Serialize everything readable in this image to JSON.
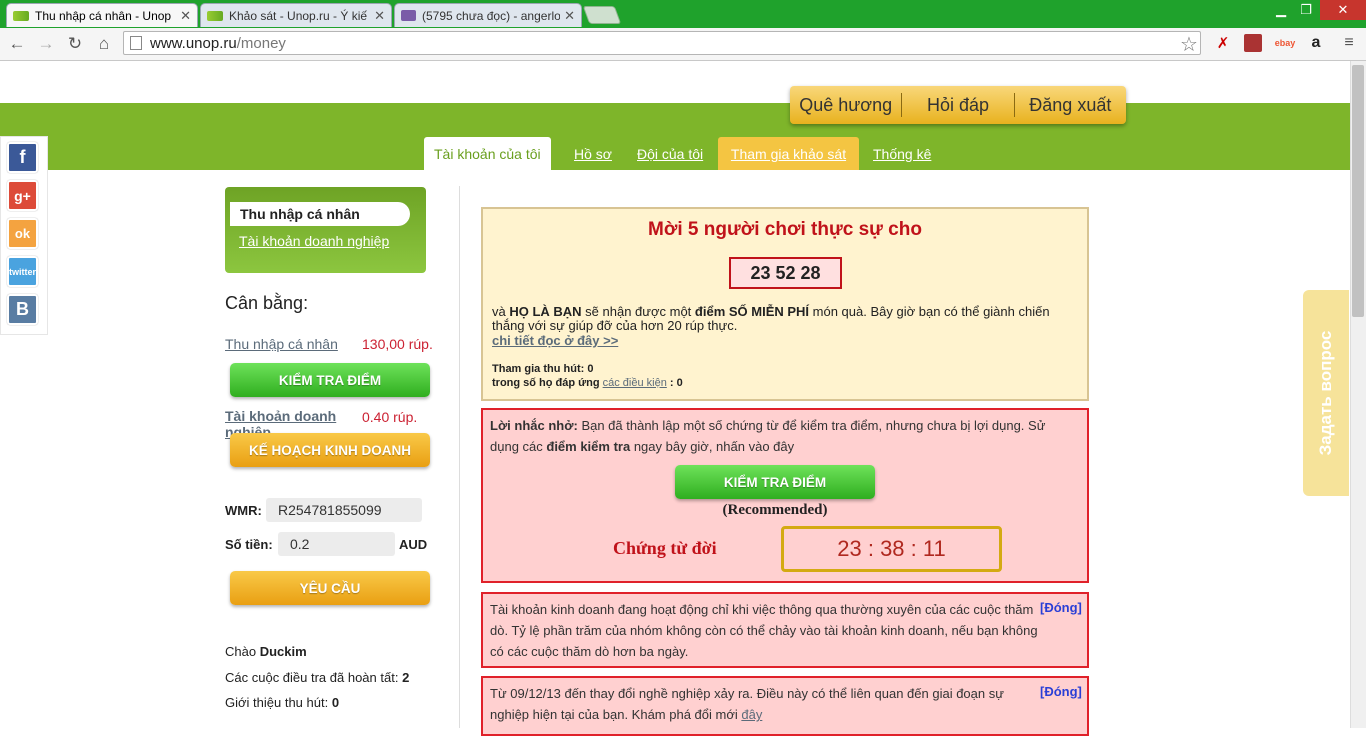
{
  "browser": {
    "tabs": [
      {
        "title": "Thu nhập cá nhân - Unop",
        "active": true
      },
      {
        "title": "Khảo sát - Unop.ru - Ý kiế",
        "active": false
      },
      {
        "title": "(5795 chưa đọc) - angerlo",
        "active": false
      }
    ],
    "url_host": "www.unop.ru",
    "url_path": "/money",
    "window_controls": [
      "minimize",
      "restore",
      "close"
    ]
  },
  "topnav": {
    "items": [
      "Quê hương",
      "Hỏi đáp",
      "Đăng xuất"
    ]
  },
  "subtabs": [
    "Tài khoản của tôi",
    "Hồ sơ",
    "Đội của tôi",
    "Tham gia khảo sát",
    "Thống kê"
  ],
  "social": [
    "f",
    "g+",
    "ok",
    "twitter",
    "B"
  ],
  "feedback": "Задать вопрос",
  "left": {
    "acct_personal": "Thu nhập cá nhân",
    "acct_business": "Tài khoản doanh nghiệp",
    "balance_title": "Cân bằng:",
    "personal_label": "Thu nhập cá nhân",
    "personal_value": "130,00 rúp.",
    "check_points_btn": "KIỂM TRA ĐIỂM",
    "business_label": "Tài khoản doanh nghiệp",
    "business_value": "0.40 rúp.",
    "business_plan_btn": "KẾ HOẠCH KINH DOANH",
    "wmr_label": "WMR:",
    "wmr_value": "R254781855099",
    "amount_label": "Số tiền:",
    "amount_value": "0.2",
    "currency": "AUD",
    "request_btn": "YÊU CẦU",
    "greeting_prefix": "Chào",
    "greeting_name": "Duckim",
    "surveys_done_label": "Các cuộc điều tra đã hoàn tất:",
    "surveys_done_value": "2",
    "referrals_label": "Giới thiệu thu hút:",
    "referrals_value": "0"
  },
  "promo": {
    "title": "Mời 5 người chơi thực sự cho",
    "timer": "23 52 28",
    "text_a": "và ",
    "text_b": "HỌ LÀ BẠN",
    "text_c": " sẽ nhận được một ",
    "text_d": "điểm SỐ MIỄN PHÍ",
    "text_e": " món quà. Bây giờ bạn có thể giành chiến thắng với sự giúp đỡ của hơn 20 rúp thực.",
    "details_link": "chi tiết đọc ở đây >>",
    "joined_label": "Tham gia thu hút:",
    "joined_value": "0",
    "conditions_prefix": "trong số họ đáp ứng",
    "conditions_link": "các điều kiện",
    "conditions_value": ": 0"
  },
  "reminder": {
    "lead": "Lời nhắc nhở:",
    "text_a": " Bạn đã thành lập một số chứng từ để kiểm tra điểm, nhưng chưa bị lợi dụng. Sử dụng các ",
    "text_b": "điểm kiểm tra",
    "text_c": " ngay bây giờ, nhấn vào đây",
    "button": "KIỂM TRA ĐIỂM",
    "recommended": "(Recommended)",
    "expiry_label": "Chứng từ đời",
    "expiry_timer": "23 : 38 : 11"
  },
  "notes": [
    {
      "text": "Tài khoản kinh doanh đang hoạt động chỉ khi việc thông qua thường xuyên của các cuộc thăm dò. Tỷ lệ phần trăm của nhóm không còn có thể chảy vào tài khoản kinh doanh, nếu bạn không có các cuộc thăm dò hơn ba ngày.",
      "close": "[Đóng]"
    },
    {
      "text": "Từ 09/12/13 đến thay đổi nghề nghiệp xảy ra. Điều này có thể liên quan đến giai đoạn sự nghiệp hiện tại của bạn. Khám phá đổi mới ",
      "link": "đây",
      "close": "[Đóng]"
    }
  ],
  "colors": {
    "brand_green": "#7eb52a",
    "alert_red": "#e0212a",
    "promo_red": "#c0121a",
    "link_blue": "#2a3fd6"
  }
}
